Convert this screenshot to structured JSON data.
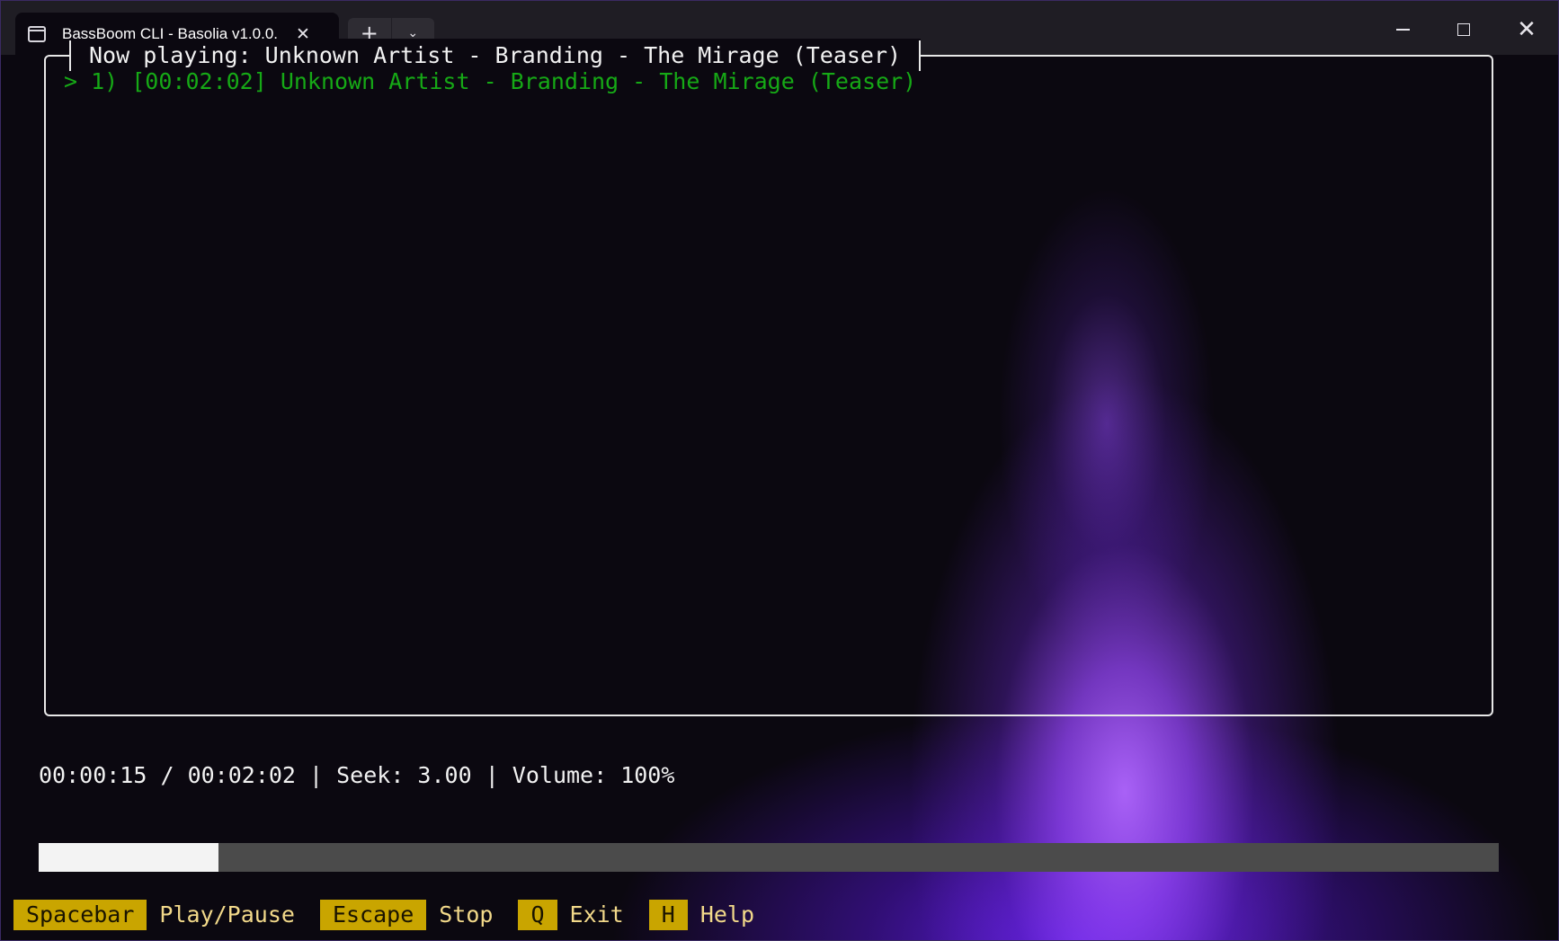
{
  "window": {
    "tab_title": "BassBoom CLI - Basolia v1.0.0.",
    "tab_icon": "terminal-icon",
    "controls": [
      "minimize-icon",
      "maximize-icon",
      "close-icon"
    ]
  },
  "player": {
    "now_playing": "Now playing: Unknown Artist - Branding - The Mirage (Teaser)",
    "playlist": [
      {
        "line": "> 1) [00:02:02] Unknown Artist - Branding - The Mirage (Teaser)"
      }
    ],
    "status_line": "00:00:15 / 00:02:02 | Seek: 3.00 | Volume: 100%",
    "progress_fraction": 0.123
  },
  "keybindings": [
    {
      "key": "Spacebar",
      "action": "Play/Pause"
    },
    {
      "key": "Escape",
      "action": "Stop"
    },
    {
      "key": "Q",
      "action": "Exit"
    },
    {
      "key": "H",
      "action": "Help"
    }
  ],
  "colors": {
    "track_text": "#16a916",
    "key_badge": "#c9a500",
    "key_text": "#f2d98a",
    "glow": "#9a4dff"
  }
}
